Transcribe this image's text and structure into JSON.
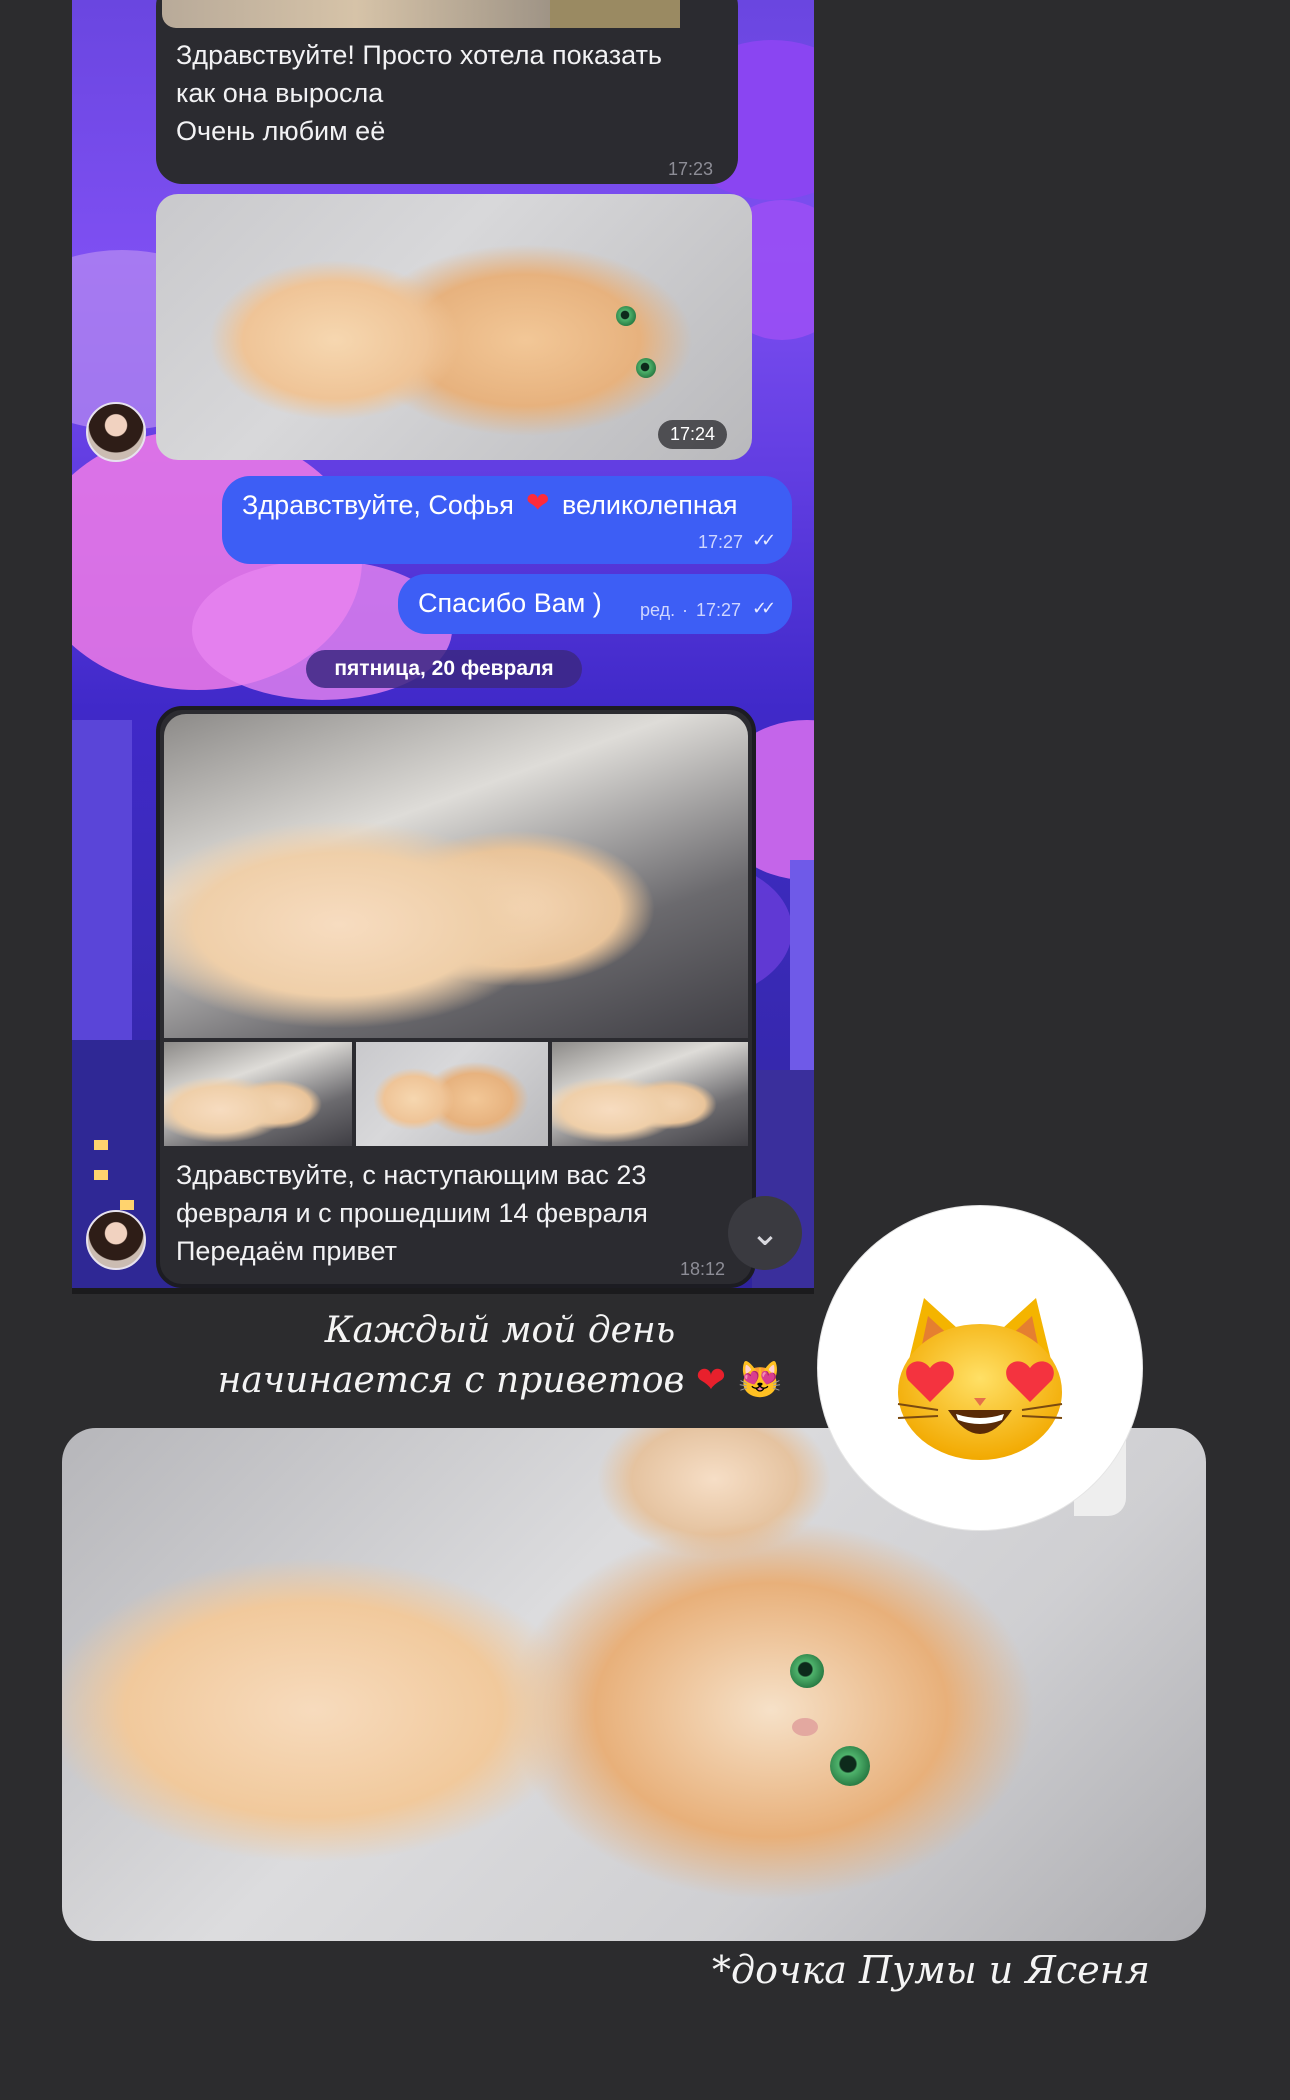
{
  "chat": {
    "msg1": {
      "lines": [
        "Здравствуйте! Просто хотела показать",
        "как она выросла",
        "Очень любим её"
      ],
      "time": "17:23"
    },
    "photo1": {
      "time": "17:24"
    },
    "out1": {
      "text": "Здравствуйте, Софья",
      "text_after": "великолепная",
      "time": "17:27"
    },
    "out2": {
      "text": "Спасибо Вам )",
      "edited": "ред.",
      "time": "17:27"
    },
    "date_separator": "пятница, 20 февраля",
    "msg2": {
      "lines": [
        "Здравствуйте, с наступающим вас 23",
        "февраля и с прошедшим 14 февраля",
        "Передаём привет"
      ],
      "time": "18:12"
    }
  },
  "story": {
    "caption_line1": "Каждый мой день",
    "caption_line2": "начинается с приветов",
    "footnote": "*дочка Пумы и Ясеня"
  },
  "colors": {
    "outgoing_bubble": "#3d5ef5",
    "incoming_bubble": "#2b2b30",
    "background": "#2c2c2e"
  },
  "icons": [
    "double-check-icon",
    "heart-emoji",
    "heart-eyes-cat-emoji",
    "chevron-down-icon"
  ]
}
